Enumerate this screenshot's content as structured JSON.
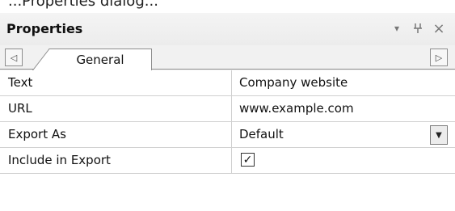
{
  "caption": "...Properties dialog...",
  "panel": {
    "title": "Properties",
    "buttons": {
      "dropdown_glyph": "▾",
      "pin_glyph": "ꟸ",
      "close_glyph": "×"
    }
  },
  "tabs": {
    "scroll_left_glyph": "◁",
    "scroll_right_glyph": "▷",
    "items": [
      {
        "label": "General",
        "selected": true
      }
    ]
  },
  "properties": [
    {
      "name": "Text",
      "value": "Company website",
      "editor": "text"
    },
    {
      "name": "URL",
      "value": "www.example.com",
      "editor": "text"
    },
    {
      "name": "Export As",
      "value": "Default",
      "editor": "combo"
    },
    {
      "name": "Include in Export",
      "value": "✓",
      "editor": "checkbox",
      "checked": true
    }
  ],
  "colors": {
    "panel_bg": "#f1f1f1",
    "grid_line": "#d0d0d0",
    "border": "#8d8d8d"
  }
}
